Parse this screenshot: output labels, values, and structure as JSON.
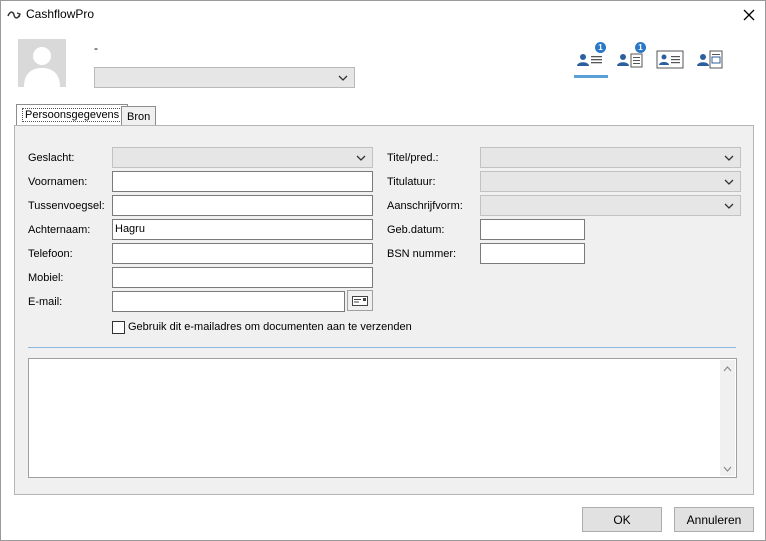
{
  "window": {
    "title": "CashflowPro"
  },
  "header": {
    "name_placeholder_dash": "-",
    "relation_select_value": ""
  },
  "view_icons": [
    {
      "name": "persoonsgegevens-view",
      "badge": "1"
    },
    {
      "name": "adressen-view",
      "badge": "1"
    },
    {
      "name": "details-view",
      "badge": ""
    },
    {
      "name": "documenten-view",
      "badge": ""
    }
  ],
  "tabs": [
    {
      "label": "Persoonsgegevens",
      "active": true
    },
    {
      "label": "Bron",
      "active": false
    }
  ],
  "form": {
    "geslacht": {
      "label": "Geslacht:",
      "value": ""
    },
    "voornamen": {
      "label": "Voornamen:",
      "value": ""
    },
    "tussenvoegsel": {
      "label": "Tussenvoegsel:",
      "value": ""
    },
    "achternaam": {
      "label": "Achternaam:",
      "value": "Hagru"
    },
    "telefoon": {
      "label": "Telefoon:",
      "value": ""
    },
    "mobiel": {
      "label": "Mobiel:",
      "value": ""
    },
    "email": {
      "label": "E-mail:",
      "value": ""
    },
    "titel": {
      "label": "Titel/pred.:",
      "value": ""
    },
    "titulatuur": {
      "label": "Titulatuur:",
      "value": ""
    },
    "aanschrijfvorm": {
      "label": "Aanschrijfvorm:",
      "value": ""
    },
    "gebdatum": {
      "label": "Geb.datum:",
      "value": ""
    },
    "bsn": {
      "label": "BSN nummer:",
      "value": ""
    },
    "use_email_checkbox": {
      "label": "Gebruik dit e-mailadres om documenten aan te verzenden",
      "checked": false
    }
  },
  "memo": {
    "value": ""
  },
  "buttons": {
    "ok": "OK",
    "cancel": "Annuleren"
  },
  "colors": {
    "accent": "#5a9fd6",
    "badge": "#2c78c8",
    "panel_bg": "#f0f0f0"
  }
}
